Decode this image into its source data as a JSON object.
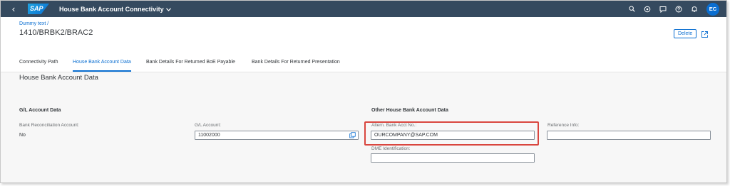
{
  "shell": {
    "title": "House Bank Account Connectivity",
    "logo": "SAP",
    "avatar_initials": "EC",
    "icons": [
      "search-icon",
      "copilot-icon",
      "feedback-icon",
      "help-icon",
      "notifications-icon"
    ]
  },
  "header": {
    "breadcrumb": "Dummy text /",
    "title": "1410/BRBK2/BRAC2",
    "delete_label": "Delete"
  },
  "tabs": [
    {
      "label": "Connectivity Path",
      "active": false
    },
    {
      "label": "House Bank Account Data",
      "active": true
    },
    {
      "label": "Bank Details For Returned BoE Payable",
      "active": false
    },
    {
      "label": "Bank Details For Returned Presentation",
      "active": false
    }
  ],
  "section": {
    "title": "House Bank Account Data",
    "gl_group": {
      "title": "G/L Account Data",
      "recon_label": "Bank Reconciliation Account:",
      "recon_value": "No",
      "gl_label": "G/L Account:",
      "gl_value": "11002000"
    },
    "other_group": {
      "title": "Other House Bank Account Data",
      "altern_label": "Altern. Bank Acct No.:",
      "altern_value": "OURCOMPANY@SAP.COM",
      "dme_label": "DME Identification:",
      "dme_value": "",
      "ref_label": "Reference Info:",
      "ref_value": ""
    }
  },
  "colors": {
    "shell_bg": "#354a5f",
    "accent": "#0a6ed1",
    "highlight": "#d9463f"
  }
}
